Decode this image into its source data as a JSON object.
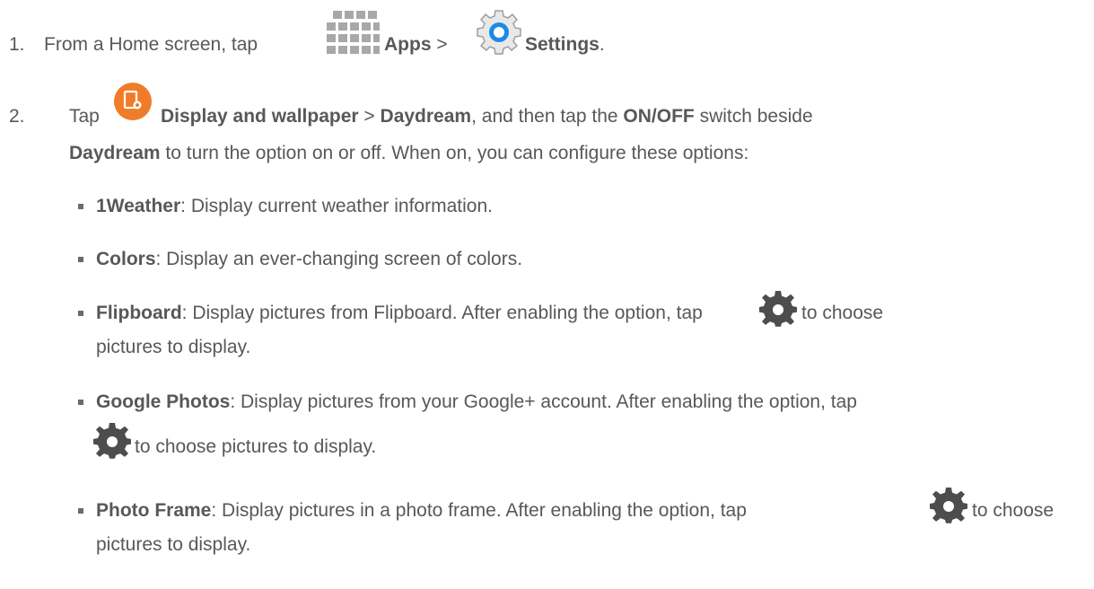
{
  "step1": {
    "number": "1.",
    "text_before": "From a Home screen, tap",
    "apps_label": "Apps",
    "sep": ">",
    "settings_label": "Settings",
    "end": ".",
    "apps_icon": "apps-grid-icon",
    "settings_icon": "settings-gear-icon"
  },
  "step2": {
    "number": "2.",
    "tap": "Tap",
    "display_label": "Display and wallpaper",
    "sep": ">",
    "daydream_label": "Daydream",
    "text_mid": ", and then tap the",
    "onoff_label": "ON/OFF",
    "text_after_onoff": "switch beside",
    "daydream_label2": "Daydream",
    "text_end": "to turn the option on or off. When on, you can configure these options:",
    "display_icon": "display-settings-icon"
  },
  "options": [
    {
      "name": "1Weather",
      "desc": ": Display current weather information."
    },
    {
      "name": "Colors",
      "desc": ": Display an ever-changing screen of colors."
    },
    {
      "name": "Flipboard",
      "desc": ": Display pictures from Flipboard. After enabling the option, tap",
      "desc2": "to choose",
      "desc3": "pictures to display."
    },
    {
      "name": "Google Photos",
      "desc": ": Display pictures from your Google+ account. After enabling the option, tap",
      "desc2": "to choose pictures to display."
    },
    {
      "name": "Photo Frame",
      "desc": ": Display pictures in a photo frame. After enabling the option, tap",
      "desc2": "to choose",
      "desc3": "pictures to display."
    }
  ],
  "colors": {
    "text": "#58585a",
    "display_icon": "#f07c2a",
    "gear": "#4d4d4d",
    "settings_ring": "#1e88e5"
  }
}
